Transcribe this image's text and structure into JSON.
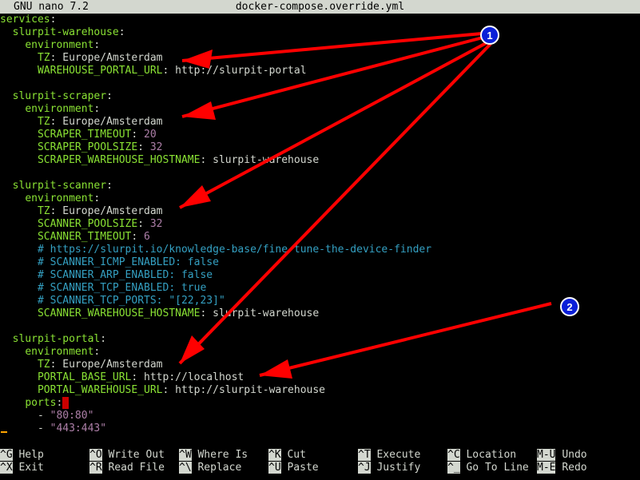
{
  "titlebar": {
    "app": "GNU nano 7.2",
    "filename": "docker-compose.override.yml"
  },
  "lines": [
    [
      "services:"
    ],
    [
      "  slurpit-warehouse:"
    ],
    [
      "    environment:"
    ],
    [
      "      TZ: Europe/Amsterdam"
    ],
    [
      "      WAREHOUSE_PORTAL_URL: http://slurpit-portal"
    ],
    [
      ""
    ],
    [
      "  slurpit-scraper:"
    ],
    [
      "    environment:"
    ],
    [
      "      TZ: Europe/Amsterdam"
    ],
    [
      "      SCRAPER_TIMEOUT: 20"
    ],
    [
      "      SCRAPER_POOLSIZE: 32"
    ],
    [
      "      SCRAPER_WAREHOUSE_HOSTNAME: slurpit-warehouse"
    ],
    [
      ""
    ],
    [
      "  slurpit-scanner:"
    ],
    [
      "    environment:"
    ],
    [
      "      TZ: Europe/Amsterdam"
    ],
    [
      "      SCANNER_POOLSIZE: 32"
    ],
    [
      "      SCANNER_TIMEOUT: 6"
    ],
    [
      "      # https://slurpit.io/knowledge-base/fine-tune-the-device-finder"
    ],
    [
      "      # SCANNER_ICMP_ENABLED: false"
    ],
    [
      "      # SCANNER_ARP_ENABLED: false"
    ],
    [
      "      # SCANNER_TCP_ENABLED: true"
    ],
    [
      "      # SCANNER_TCP_PORTS: \"[22,23]\""
    ],
    [
      "      SCANNER_WAREHOUSE_HOSTNAME: slurpit-warehouse"
    ],
    [
      ""
    ],
    [
      "  slurpit-portal:"
    ],
    [
      "    environment:"
    ],
    [
      "      TZ: Europe/Amsterdam"
    ],
    [
      "      PORTAL_BASE_URL: http://localhost"
    ],
    [
      "      PORTAL_WAREHOUSE_URL: http://slurpit-warehouse"
    ],
    [
      "    ports:"
    ],
    [
      "      - \"80:80\""
    ],
    [
      "      - \"443:443\""
    ]
  ],
  "shortcuts": [
    {
      "key": "^G",
      "label": "Help"
    },
    {
      "key": "^X",
      "label": "Exit"
    },
    {
      "key": "^O",
      "label": "Write Out"
    },
    {
      "key": "^R",
      "label": "Read File"
    },
    {
      "key": "^W",
      "label": "Where Is"
    },
    {
      "key": "^\\",
      "label": "Replace"
    },
    {
      "key": "^K",
      "label": "Cut"
    },
    {
      "key": "^U",
      "label": "Paste"
    },
    {
      "key": "^T",
      "label": "Execute"
    },
    {
      "key": "^J",
      "label": "Justify"
    },
    {
      "key": "^C",
      "label": "Location"
    },
    {
      "key": "^_",
      "label": "Go To Line"
    },
    {
      "key": "M-U",
      "label": "Undo"
    },
    {
      "key": "M-E",
      "label": "Redo"
    }
  ],
  "annotations": {
    "badge1": "1",
    "badge2": "2",
    "arrow_color": "#ff0000",
    "badge_color": "#0a1fd8"
  }
}
